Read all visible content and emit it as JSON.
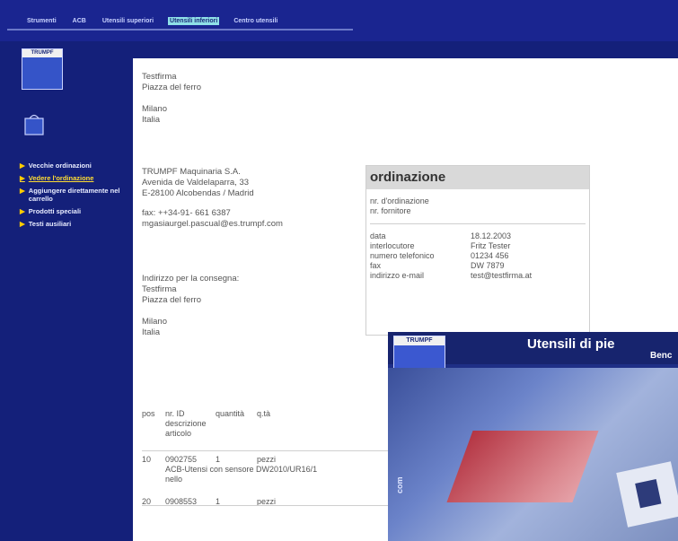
{
  "top_nav": {
    "items": [
      "Strumenti",
      "ACB",
      "Utensili superiori",
      "Utensili inferiori",
      "Centro utensili"
    ],
    "active_index": 3
  },
  "sidebar": {
    "logo_text": "TRUMPF",
    "menu": [
      {
        "label": "Vecchie ordinazioni",
        "active": false
      },
      {
        "label": "Vedere l'ordinazione",
        "active": true
      },
      {
        "label": "Aggiungere direttamente nel carrello",
        "active": false
      },
      {
        "label": "Prodotti speciali",
        "active": false
      },
      {
        "label": "Testi ausiliari",
        "active": false
      }
    ]
  },
  "customer": {
    "name": "Testfirma",
    "street": "Piazza del ferro",
    "city": "Milano",
    "country": "Italia"
  },
  "supplier": {
    "name": "TRUMPF Maquinaria S.A.",
    "address1": "Avenida de Valdelaparra, 33",
    "address2": "E-28100 Alcobendas / Madrid",
    "fax": "fax: ++34-91- 661 6387",
    "email": "mgasiaurgel.pascual@es.trumpf.com"
  },
  "delivery": {
    "heading": "Indirizzo per la consegna:",
    "name": "Testfirma",
    "street": "Piazza del ferro",
    "city": "Milano",
    "country": "Italia"
  },
  "order_box": {
    "heading": "ordinazione",
    "labels": [
      "nr. d'ordinazione",
      "nr. fornitore"
    ],
    "rows": [
      {
        "k": "data",
        "v": "18.12.2003"
      },
      {
        "k": "interlocutore",
        "v": "Fritz Tester"
      },
      {
        "k": "numero telefonico",
        "v": "01234 456"
      },
      {
        "k": "fax",
        "v": "DW 7879"
      },
      {
        "k": "indirizzo e-mail",
        "v": "test@testfirma.at"
      }
    ]
  },
  "items_table": {
    "headers": [
      "pos",
      "nr. ID",
      "quantità",
      "q.tà"
    ],
    "header2": "descrizione",
    "header3": "articolo",
    "rows": [
      {
        "pos": "10",
        "id": "0902755",
        "qty": "1",
        "unit": "pezzi",
        "desc": "ACB-Utensi con sensore DW2010/UR16/1",
        "note": "nello"
      },
      {
        "pos": "20",
        "id": "0908553",
        "qty": "1",
        "unit": "pezzi",
        "desc": "",
        "note": ""
      }
    ]
  },
  "popup": {
    "logo_text": "TRUMPF",
    "title": "Utensili di pie",
    "subtitle": "Benc",
    "side_text": "com"
  }
}
